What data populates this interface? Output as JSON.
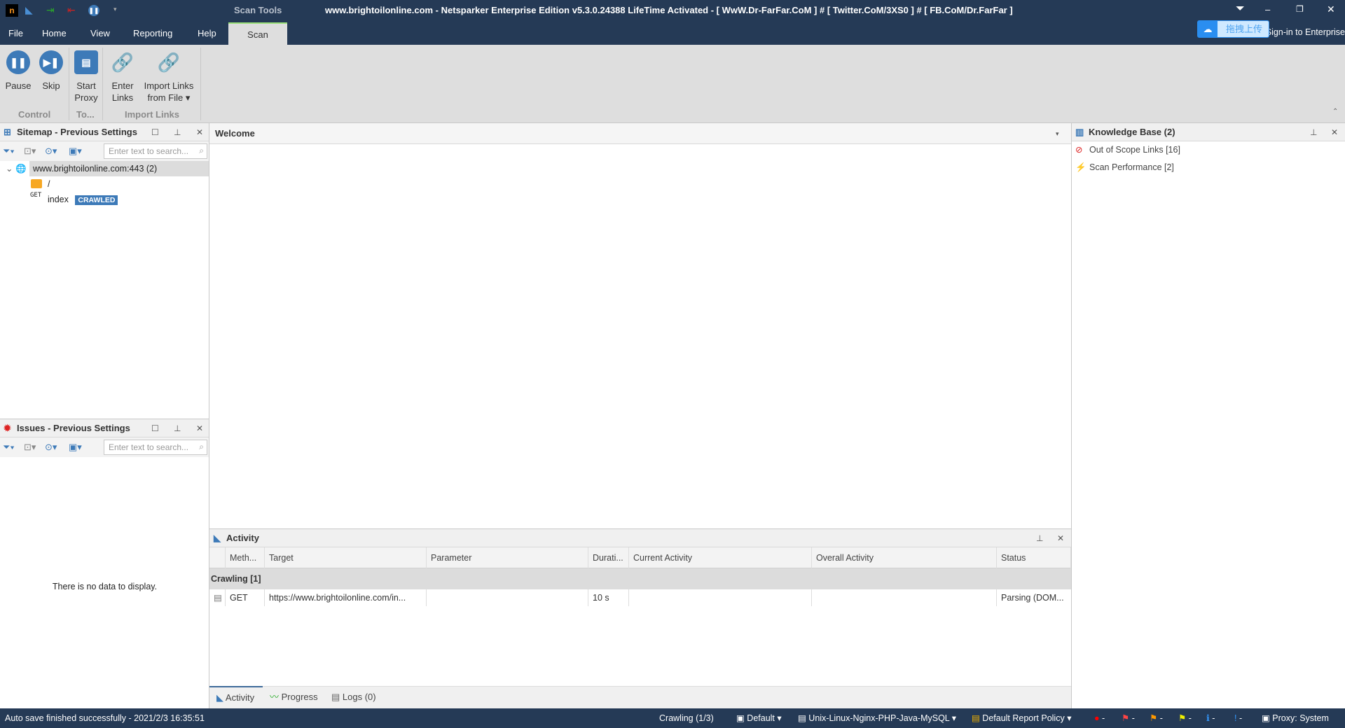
{
  "titlebar": {
    "context_tab": "Scan Tools",
    "title": "www.brightoilonline.com - Netsparker Enterprise Edition v5.3.0.24388 LifeTime Activated - [ WwW.Dr-FarFar.CoM ] # [ Twitter.CoM/3XS0 ] # [ FB.CoM/Dr.FarFar ]",
    "upload_overlay": "拖拽上传",
    "signin": "Sign-in to Enterprise"
  },
  "menu": [
    "File",
    "Home",
    "View",
    "Reporting",
    "Help",
    "Scan"
  ],
  "ribbon": {
    "buttons": [
      {
        "label": "Pause",
        "icon": "pause-icon"
      },
      {
        "label": "Skip",
        "icon": "skip-icon"
      },
      {
        "label": "Start Proxy",
        "icon": "proxy-icon"
      },
      {
        "label": "Enter Links",
        "icon": "link-icon"
      },
      {
        "label": "Import Links from File",
        "icon": "import-link-icon"
      }
    ],
    "groups": [
      "Control",
      "To...",
      "Import Links"
    ]
  },
  "sitemap": {
    "title": "Sitemap - Previous Settings",
    "search_placeholder": "Enter text to search...",
    "root": "www.brightoilonline.com:443 (2)",
    "children": [
      {
        "label": "/"
      },
      {
        "label": "index",
        "method": "GET",
        "badge": "CRAWLED"
      }
    ]
  },
  "issues": {
    "title": "Issues - Previous Settings",
    "search_placeholder": "Enter text to search...",
    "empty": "There is no data to display."
  },
  "welcome": {
    "title": "Welcome"
  },
  "activity": {
    "title": "Activity",
    "columns": [
      "Meth...",
      "Target",
      "Parameter",
      "Durati...",
      "Current Activity",
      "Overall Activity",
      "Status"
    ],
    "group": "Crawling [1]",
    "rows": [
      {
        "method": "GET",
        "target": "https://www.brightoilonline.com/in...",
        "parameter": "",
        "duration": "10 s",
        "current": "",
        "overall": "",
        "status": "Parsing (DOM..."
      }
    ],
    "tabs": [
      "Activity",
      "Progress",
      "Logs (0)"
    ]
  },
  "knowledge_base": {
    "title": "Knowledge Base (2)",
    "items": [
      "Out of Scope Links [16]",
      "Scan Performance [2]"
    ]
  },
  "statusbar": {
    "autosave": "Auto save finished successfully - 2021/2/3 16:35:51",
    "crawling": "Crawling (1/3)",
    "profile": "Default",
    "policy": "Unix-Linux-Nginx-PHP-Java-MySQL",
    "report_policy": "Default Report Policy",
    "counts": [
      "-",
      "-",
      "-",
      "-",
      "-",
      "-"
    ],
    "proxy": "Proxy: System"
  },
  "colors": {
    "chrome": "#253a56",
    "accent": "#3d7ab8",
    "badge": "#3d7ab8"
  }
}
